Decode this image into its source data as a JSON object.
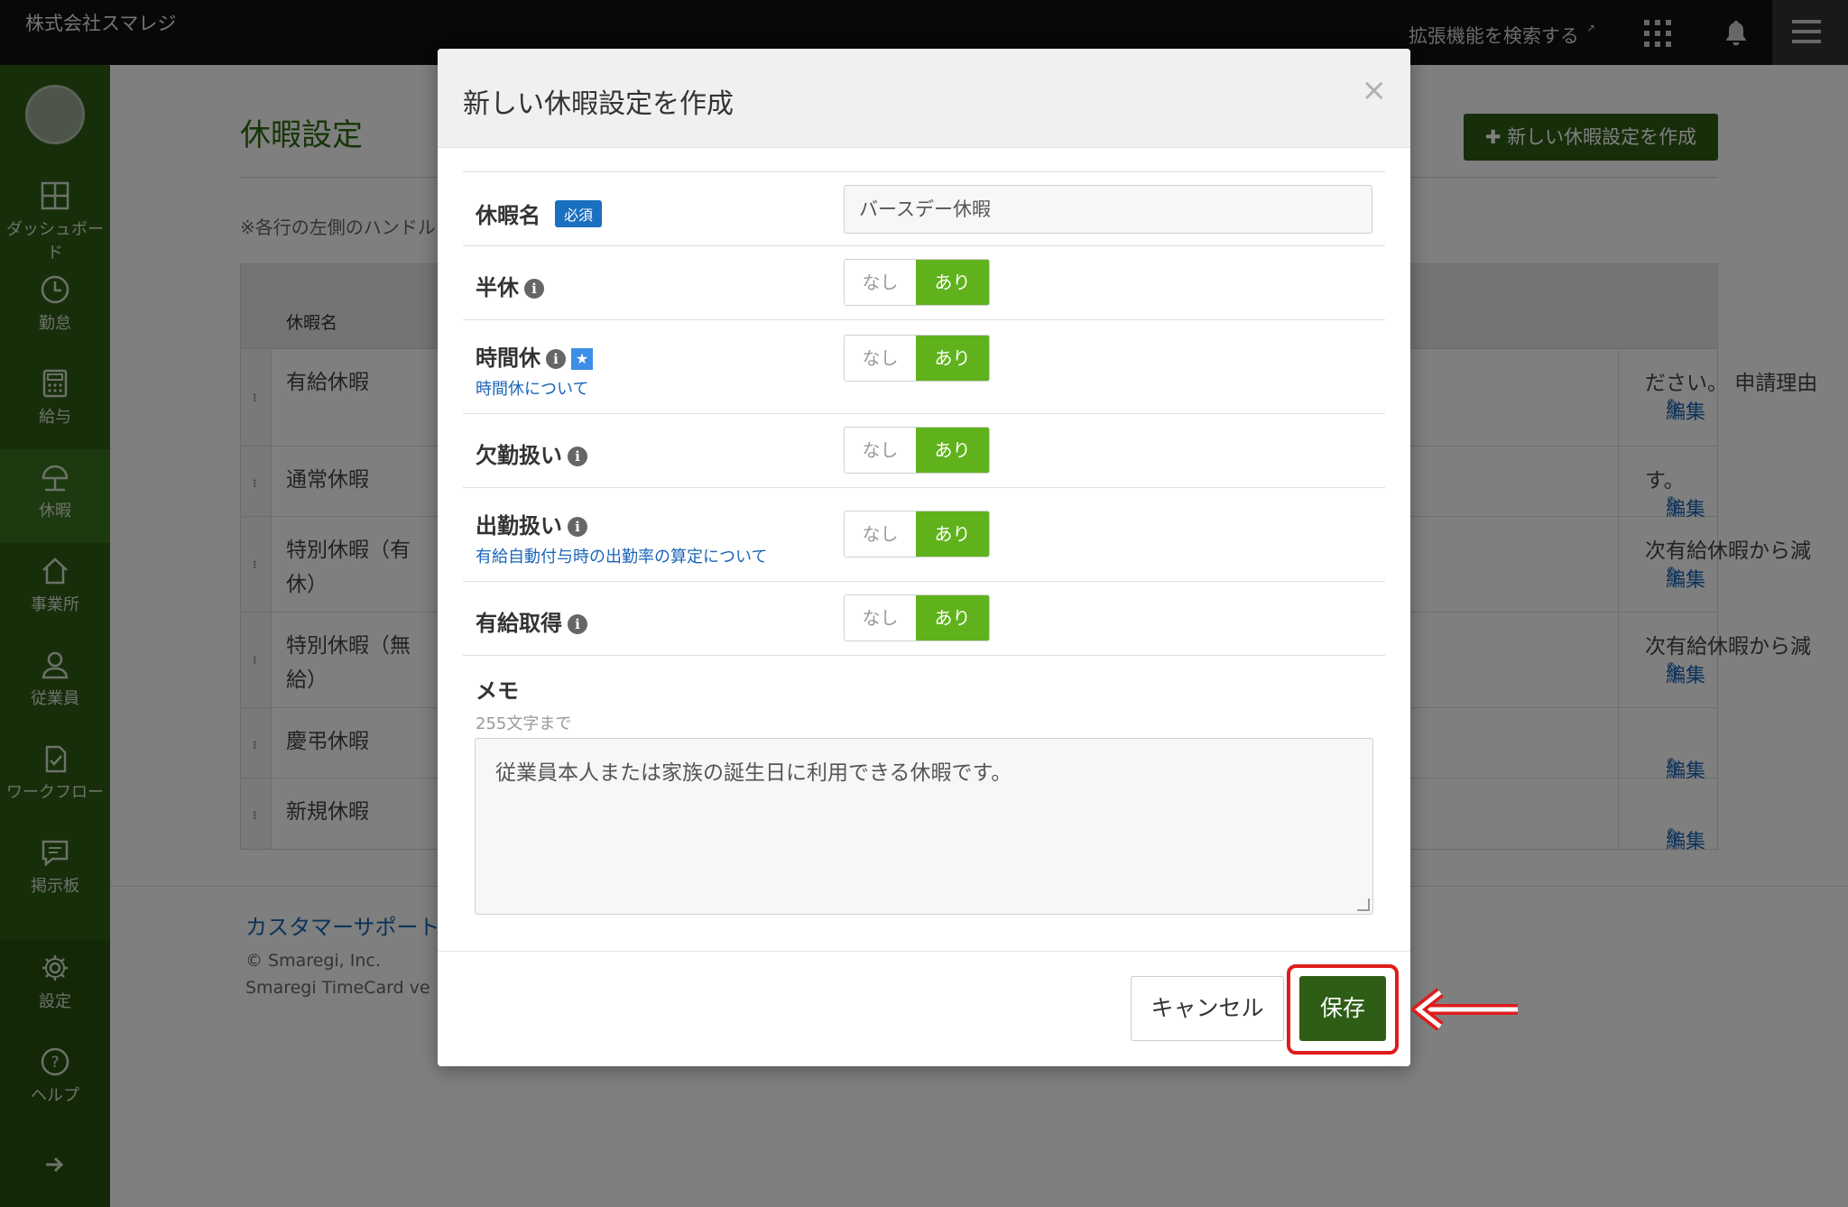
{
  "topbar": {
    "company": "株式会社スマレジ",
    "extension_link": "拡張機能を検索する",
    "icons": [
      "apps-grid-icon",
      "bell-icon",
      "hamburger-menu-icon"
    ]
  },
  "sidebar": {
    "items": [
      {
        "label": "ダッシュボード",
        "icon": "dashboard-icon"
      },
      {
        "label": "勤怠",
        "icon": "clock-icon"
      },
      {
        "label": "給与",
        "icon": "calculator-icon"
      },
      {
        "label": "休暇",
        "icon": "umbrella-icon"
      },
      {
        "label": "事業所",
        "icon": "house-icon"
      },
      {
        "label": "従業員",
        "icon": "person-icon"
      },
      {
        "label": "ワークフロー",
        "icon": "checklist-icon"
      },
      {
        "label": "掲示板",
        "icon": "chat-icon"
      },
      {
        "label": "設定",
        "icon": "gear-icon"
      },
      {
        "label": "ヘルプ",
        "icon": "help-icon"
      }
    ],
    "active": "休暇"
  },
  "page": {
    "title": "休暇設定",
    "new_button": "新しい休暇設定を作成",
    "hint": "※各行の左側のハンドル",
    "table": {
      "header_name": "休暇名",
      "rows": [
        {
          "name": "有給休暇",
          "desc": "ださい。 申請理由",
          "edit": "編集"
        },
        {
          "name": "通常休暇",
          "desc": "す。",
          "edit": "編集"
        },
        {
          "name": "特別休暇（有休）",
          "desc": "次有給休暇から減",
          "edit": "編集"
        },
        {
          "name": "特別休暇（無給）",
          "desc": "次有給休暇から減",
          "edit": "編集"
        },
        {
          "name": "慶弔休暇",
          "desc": "",
          "edit": "編集"
        },
        {
          "name": "新規休暇",
          "desc": "",
          "edit": "編集"
        }
      ]
    },
    "footer": {
      "support": "カスタマーサポート",
      "copyright": "© Smaregi, Inc.",
      "version": "Smaregi TimeCard ve"
    }
  },
  "modal": {
    "title": "新しい休暇設定を作成",
    "close": "×",
    "fields": {
      "name": {
        "label": "休暇名",
        "badge": "必須",
        "value": "バースデー休暇"
      },
      "half_day": {
        "label": "半休",
        "off": "なし",
        "on": "あり"
      },
      "hourly": {
        "label": "時間休",
        "link": "時間休について",
        "off": "なし",
        "on": "あり"
      },
      "absence": {
        "label": "欠勤扱い",
        "off": "なし",
        "on": "あり"
      },
      "attendance": {
        "label": "出勤扱い",
        "link": "有給自動付与時の出勤率の算定について",
        "off": "なし",
        "on": "あり"
      },
      "paid_leave": {
        "label": "有給取得",
        "off": "なし",
        "on": "あり"
      }
    },
    "memo": {
      "label": "メモ",
      "hint": "255文字まで",
      "value": "従業員本人または家族の誕生日に利用できる休暇です。"
    },
    "buttons": {
      "cancel": "キャンセル",
      "save": "保存"
    }
  },
  "colors": {
    "accent_green": "#2e5d16",
    "toggle_on": "#5fb21b",
    "link_blue": "#1b65b8",
    "annotation_red": "#e01b1b"
  }
}
